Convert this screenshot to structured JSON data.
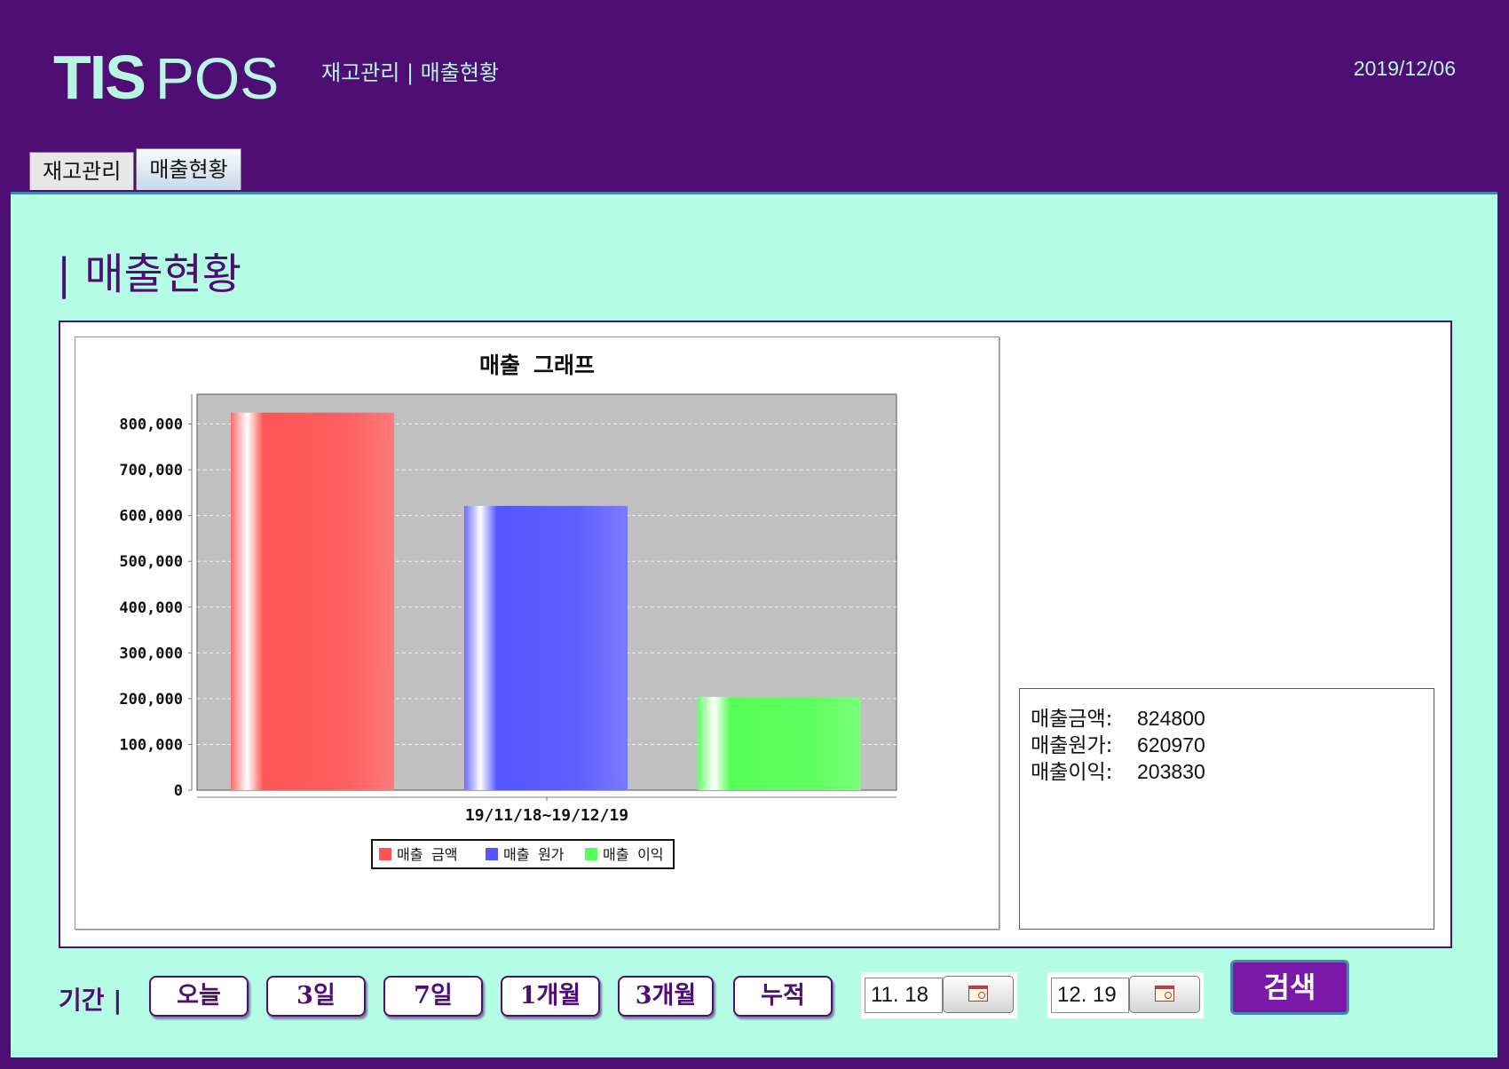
{
  "header": {
    "logo_brand": "TIS",
    "logo_product": "POS",
    "breadcrumb": "재고관리 | 매출현황",
    "date": "2019/12/06"
  },
  "tabs": [
    {
      "label": "재고관리",
      "active": false
    },
    {
      "label": "매출현황",
      "active": true
    }
  ],
  "page_title": "| 매출현황",
  "summary": {
    "rows": [
      {
        "label": "매출금액:",
        "value": "824800"
      },
      {
        "label": "매출원가:",
        "value": "620970"
      },
      {
        "label": "매출이익:",
        "value": "203830"
      }
    ]
  },
  "period": {
    "label": "기간 |",
    "buttons": [
      "오늘",
      "3일",
      "7일",
      "1개월",
      "3개월",
      "누적"
    ],
    "start_date": "11. 18",
    "end_date": "12. 19",
    "separator": "~",
    "search_label": "검색"
  },
  "colors": {
    "brand_purple": "#4e0e74",
    "mint": "#b4fce4",
    "plot_bg": "#c0c0c0"
  },
  "chart_data": {
    "type": "bar",
    "title": "매출 그래프",
    "categories": [
      "19/11/18~19/12/19"
    ],
    "series": [
      {
        "name": "매출 금액",
        "values": [
          824800
        ],
        "color": "#ff5555"
      },
      {
        "name": "매출 원가",
        "values": [
          620970
        ],
        "color": "#5555ff"
      },
      {
        "name": "매출 이익",
        "values": [
          203830
        ],
        "color": "#55ff55"
      }
    ],
    "xlabel": "",
    "ylabel": "",
    "ylim": [
      0,
      865000
    ],
    "yticks": [
      0,
      100000,
      200000,
      300000,
      400000,
      500000,
      600000,
      700000,
      800000
    ],
    "ytick_labels": [
      "0",
      "100,000",
      "200,000",
      "300,000",
      "400,000",
      "500,000",
      "600,000",
      "700,000",
      "800,000"
    ],
    "grid": true,
    "legend_position": "bottom-center"
  }
}
